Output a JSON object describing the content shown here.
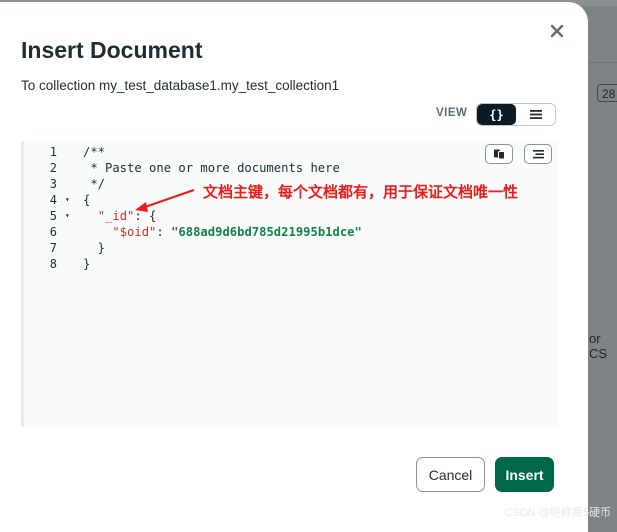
{
  "background": {
    "pill_text": "28",
    "side_text": "or CS"
  },
  "watermark": "CSDN @呢称是5硬币",
  "modal": {
    "title": "Insert Document",
    "subtitle": "To collection my_test_database1.my_test_collection1",
    "close_icon": "close-icon",
    "view": {
      "label": "VIEW",
      "json_label": "{}",
      "list_icon": "list-icon",
      "active": "json"
    },
    "editor": {
      "line_numbers": [
        "1",
        "2",
        "3",
        "4",
        "5",
        "6",
        "7",
        "8"
      ],
      "fold_markers": {
        "4": "▾",
        "5": "▾"
      },
      "code": {
        "l1": "/**",
        "l2": " * Paste one or more documents here",
        "l3": " */",
        "l4": "{",
        "l5_key": "\"_id\"",
        "l5_rest": ": {",
        "l6_key": "\"$oid\"",
        "l6_colon": ": ",
        "l6_val": "\"688ad9d6bd785d21995b1dce\"",
        "l7": "  }",
        "l8": "}"
      },
      "copy_icon": "copy-icon",
      "format_icon": "format-icon"
    },
    "annotation": "文档主键，每个文档都有，用于保证文档唯一性",
    "buttons": {
      "cancel": "Cancel",
      "insert": "Insert"
    }
  },
  "colors": {
    "accent": "#00684a",
    "annotation": "#ea1d1d",
    "json_key": "#c2362e",
    "json_string": "#12824d"
  }
}
